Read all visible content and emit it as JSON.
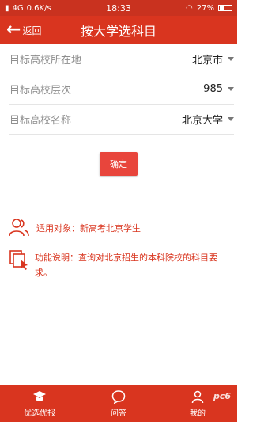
{
  "status_bar": {
    "network": "4G",
    "speed": "0.6K/s",
    "time": "18:33",
    "battery": "27%"
  },
  "header": {
    "back_label": "返回",
    "title": "按大学选科目"
  },
  "form": {
    "rows": [
      {
        "label": "目标高校所在地",
        "value": "北京市"
      },
      {
        "label": "目标高校层次",
        "value": "985"
      },
      {
        "label": "目标高校名称",
        "value": "北京大学"
      }
    ]
  },
  "confirm_label": "确定",
  "info": {
    "audience": "适用对象：新高考北京学生",
    "description": "功能说明：查询对北京招生的本科院校的科目要求。"
  },
  "tabbar": {
    "items": [
      {
        "label": "优选优报",
        "icon": "graduation-cap-icon"
      },
      {
        "label": "问答",
        "icon": "chat-bubble-icon"
      },
      {
        "label": "我的",
        "icon": "user-icon"
      }
    ]
  },
  "watermark": "pc6"
}
